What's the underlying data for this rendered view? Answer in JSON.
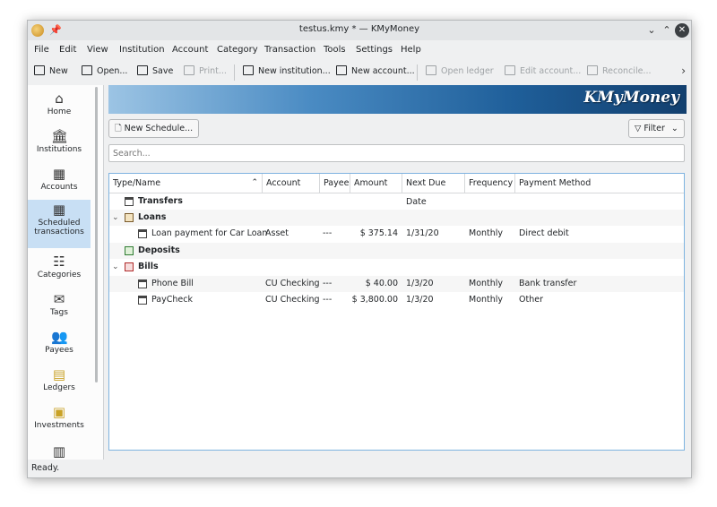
{
  "window": {
    "title": "testus.kmy * — KMyMoney"
  },
  "window_buttons": {
    "minimize": "⌄",
    "maximize": "⌃",
    "close": "✕"
  },
  "menu": [
    "File",
    "Edit",
    "View",
    "Institution",
    "Account",
    "Category",
    "Transaction",
    "Tools",
    "Settings",
    "Help"
  ],
  "toolbar": {
    "new": "New",
    "open": "Open...",
    "save": "Save",
    "print": "Print...",
    "new_institution": "New institution...",
    "new_account": "New account...",
    "open_ledger": "Open ledger",
    "edit_account": "Edit account...",
    "reconcile": "Reconcile..."
  },
  "sidebar": {
    "items": [
      {
        "label": "Home",
        "icon": "home-icon"
      },
      {
        "label": "Institutions",
        "icon": "bank-icon"
      },
      {
        "label": "Accounts",
        "icon": "accounts-icon"
      },
      {
        "label": "Scheduled transactions",
        "icon": "calendar-icon"
      },
      {
        "label": "Categories",
        "icon": "categories-icon"
      },
      {
        "label": "Tags",
        "icon": "tag-icon"
      },
      {
        "label": "Payees",
        "icon": "people-icon"
      },
      {
        "label": "Ledgers",
        "icon": "ledger-icon"
      },
      {
        "label": "Investments",
        "icon": "investments-icon"
      }
    ]
  },
  "banner": {
    "logo": "KMyMoney"
  },
  "actions": {
    "new_schedule": "New Schedule...",
    "filter": "Filter"
  },
  "search": {
    "placeholder": "Search..."
  },
  "table": {
    "columns": [
      "Type/Name",
      "Account",
      "Payee",
      "Amount",
      "Next Due Date",
      "Frequency",
      "Payment Method"
    ],
    "groups": {
      "transfers": "Transfers",
      "loans": "Loans",
      "deposits": "Deposits",
      "bills": "Bills"
    },
    "rows": [
      {
        "name": "Loan payment for Car Loan",
        "account": "Asset",
        "payee": "---",
        "amount": "$ 375.14",
        "due": "1/31/20",
        "frequency": "Monthly",
        "method": "Direct debit"
      },
      {
        "name": "Phone Bill",
        "account": "CU Checking",
        "payee": "---",
        "amount": "$ 40.00",
        "due": "1/3/20",
        "frequency": "Monthly",
        "method": "Bank transfer"
      },
      {
        "name": "PayCheck",
        "account": "CU Checking",
        "payee": "---",
        "amount": "$ 3,800.00",
        "due": "1/3/20",
        "frequency": "Monthly",
        "method": "Other"
      }
    ]
  },
  "status": {
    "text": "Ready."
  },
  "colors": {
    "accent": "#3daee9",
    "selection": "#c8dff4"
  }
}
